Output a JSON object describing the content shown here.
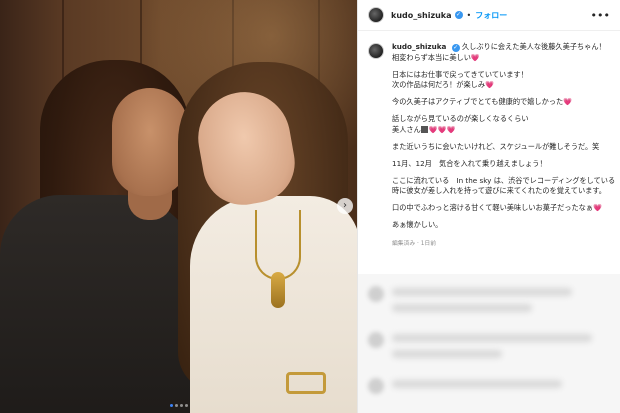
{
  "post": {
    "username": "kudo_shizuka",
    "follow_label": "フォロー",
    "separator": "•",
    "more_label": "•••",
    "carousel_next_label": "›",
    "caption": {
      "line1": "久しぶりに会えた美人な後藤久美子ちゃん！",
      "line2": "相変わらず本当に美しい",
      "line3": "日本にはお仕事で戻ってきていています！",
      "line4": "次の作品は何だろ！が楽しみ",
      "line5": "今の久美子はアクティブでとても健康的で嬉しかった",
      "line6": "話しながら見ているのが楽しくなるくらい",
      "line7": "美人さん",
      "line8": "また近いうちに会いたいけれど、スケジュールが難しそうだ。笑",
      "line9": "11月、12月　気合を入れて乗り越えましょう！",
      "line10": "ここに流れている　In the sky は、渋谷でレコーディングをしている時に彼女が差し入れを持って遊びに来てくれたのを覚えています。",
      "line11": "口の中でふわっと溶ける甘くて軽い美味しいお菓子だったなぁ",
      "line12": "あぁ懐かしい。"
    },
    "line10a": "ここに流れている　In the sky は、渋谷でレコーディングをしている",
    "line10b": "時に彼女が差し入れを持って遊びに来てくれたのを覚えています。",
    "meta": "編集済み · 1日前",
    "heart_glyph": "💗",
    "hearts3": "💗💗💗"
  },
  "colors": {
    "accent": "#0095f6",
    "verified": "#3897f0",
    "heart": "#e5347c"
  }
}
